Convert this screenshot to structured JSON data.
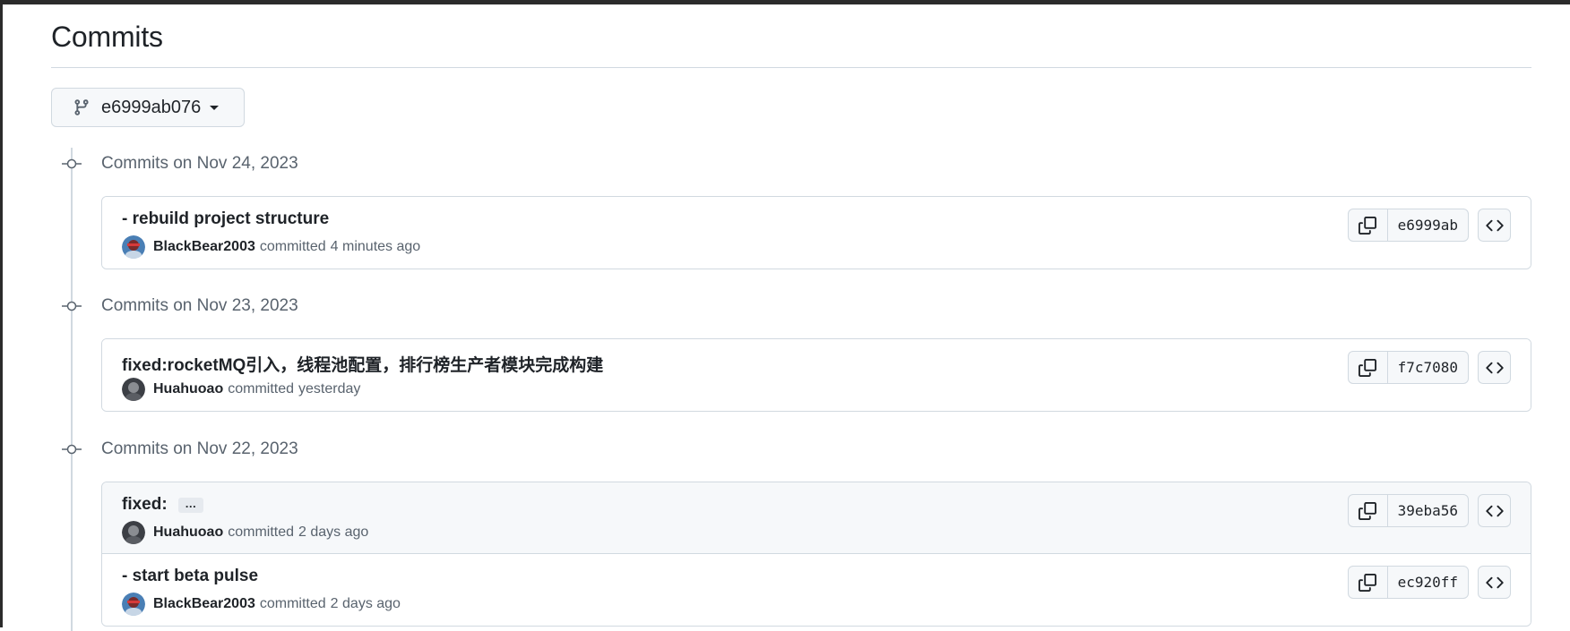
{
  "page": {
    "title": "Commits"
  },
  "branch_selector": {
    "label": "e6999ab076",
    "icon": "git-branch-icon"
  },
  "groups": [
    {
      "date": "Commits on Nov 24, 2023",
      "commits": [
        {
          "message": "- rebuild project structure",
          "author": "BlackBear2003",
          "action": "committed",
          "time": "4 minutes ago",
          "hash": "e6999ab"
        }
      ]
    },
    {
      "date": "Commits on Nov 23, 2023",
      "commits": [
        {
          "message": "fixed:rocketMQ引入，线程池配置，排行榜生产者模块完成构建",
          "author": "Huahuoao",
          "action": "committed",
          "time": "yesterday",
          "hash": "f7c7080"
        }
      ]
    },
    {
      "date": "Commits on Nov 22, 2023",
      "commits": [
        {
          "message": "fixed:",
          "ellipsis": "…",
          "author": "Huahuoao",
          "action": "committed",
          "time": "2 days ago",
          "hash": "39eba56"
        },
        {
          "message": "- start beta pulse",
          "author": "BlackBear2003",
          "action": "committed",
          "time": "2 days ago",
          "hash": "ec920ff"
        }
      ]
    }
  ],
  "colors": {
    "border": "#d1d9e0",
    "muted_text": "#59636e",
    "text": "#1f2328",
    "button_bg": "#f6f8fa"
  }
}
